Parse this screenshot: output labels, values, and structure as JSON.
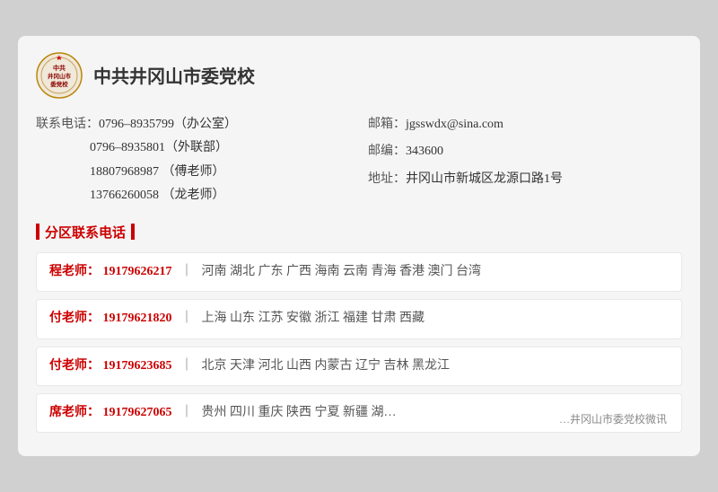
{
  "header": {
    "org_name": "中共井冈山市委党校"
  },
  "contact_info": {
    "left": [
      {
        "label": "联系电话：",
        "value": "0796–8935799（办公室）"
      },
      {
        "label": "",
        "value": "0796–8935801（外联部）"
      },
      {
        "label": "",
        "value": "18807968987  （傅老师）"
      },
      {
        "label": "",
        "value": "13766260058  （龙老师）"
      }
    ],
    "right": [
      {
        "label": "邮箱：",
        "value": "jgsswdx@sina.com"
      },
      {
        "label": "邮编：",
        "value": "343600"
      },
      {
        "label": "地址：",
        "value": "井冈山市新城区龙源口路1号"
      }
    ]
  },
  "section_title": "分区联系电话",
  "contacts": [
    {
      "teacher": "程老师：",
      "phone": "19179626217",
      "separator": "｜",
      "regions": "河南  湖北  广东  广西  海南  云南  青海  香港  澳门  台湾"
    },
    {
      "teacher": "付老师：",
      "phone": "19179621820",
      "separator": "｜",
      "regions": "上海  山东  江苏  安徽  浙江  福建  甘肃  西藏"
    },
    {
      "teacher": "付老师：",
      "phone": "19179623685",
      "separator": "｜",
      "regions": "北京  天津  河北  山西  内蒙古  辽宁  吉林  黑龙江"
    },
    {
      "teacher": "席老师：",
      "phone": "19179627065",
      "separator": "｜",
      "regions": "贵州  四川  重庆  陕西  宁夏  新疆  湖…"
    }
  ],
  "watermark": "…井冈山市委党校微讯"
}
